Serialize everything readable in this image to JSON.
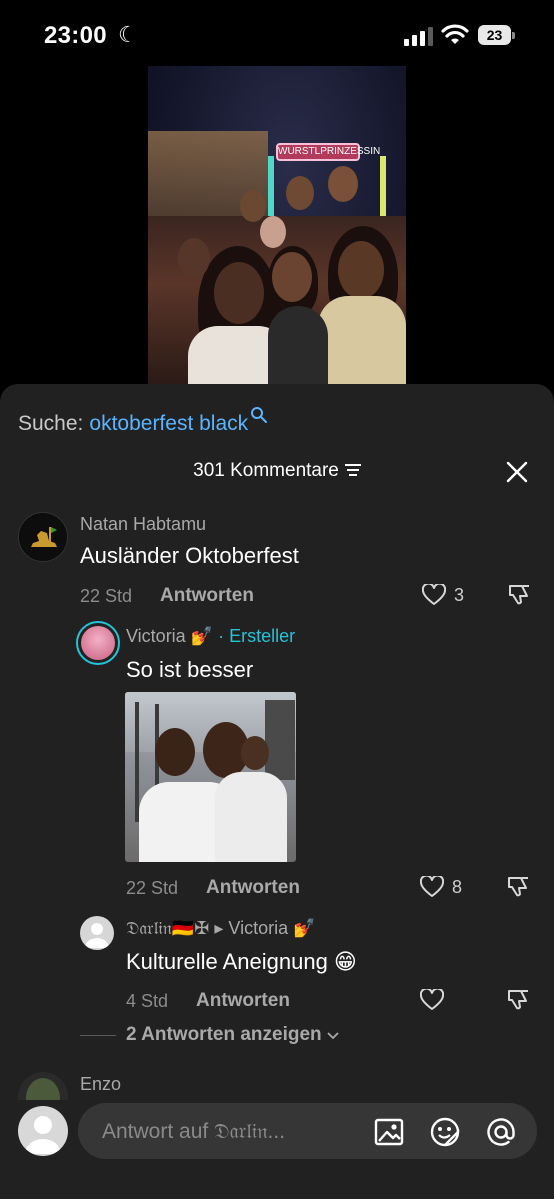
{
  "status_bar": {
    "time": "23:00",
    "battery": "23"
  },
  "search": {
    "label": "Suche:",
    "query": "oktoberfest black"
  },
  "video": {
    "sign_text": "WURSTLPRINZESSIN"
  },
  "comments_header": {
    "count_label": "301 Kommentare"
  },
  "comments": [
    {
      "author": "Natan Habtamu",
      "text": "Ausländer Oktoberfest",
      "time": "22 Std",
      "reply_label": "Antworten",
      "likes": "3"
    }
  ],
  "replies": [
    {
      "author": "Victoria 💅",
      "separator": "·",
      "badge": "Ersteller",
      "text": "So ist besser",
      "time": "22 Std",
      "reply_label": "Antworten",
      "likes": "8",
      "has_image": true
    },
    {
      "author": "𝔇𝔞𝔯𝔩𝔦𝔫🇩🇪✠",
      "reply_to_arrow": "▸",
      "reply_to": "Victoria 💅",
      "text": "Kulturelle Aneignung 😁",
      "time": "4 Std",
      "reply_label": "Antworten",
      "likes": ""
    }
  ],
  "show_more": {
    "label": "2 Antworten anzeigen"
  },
  "next_comment": {
    "author": "Enzo"
  },
  "input": {
    "placeholder": "Antwort auf 𝔇𝔞𝔯𝔩𝔦𝔫..."
  },
  "icons": [
    "moon-icon",
    "signal-icon",
    "wifi-icon",
    "battery-icon",
    "search-icon",
    "sort-icon",
    "close-icon",
    "heart-icon",
    "dislike-icon",
    "chevron-down-icon",
    "image-icon",
    "sticker-icon",
    "mention-icon"
  ],
  "colors": {
    "link_blue": "#5ab4ff",
    "creator_teal": "#25c3d8",
    "sheet_bg": "#212121"
  }
}
